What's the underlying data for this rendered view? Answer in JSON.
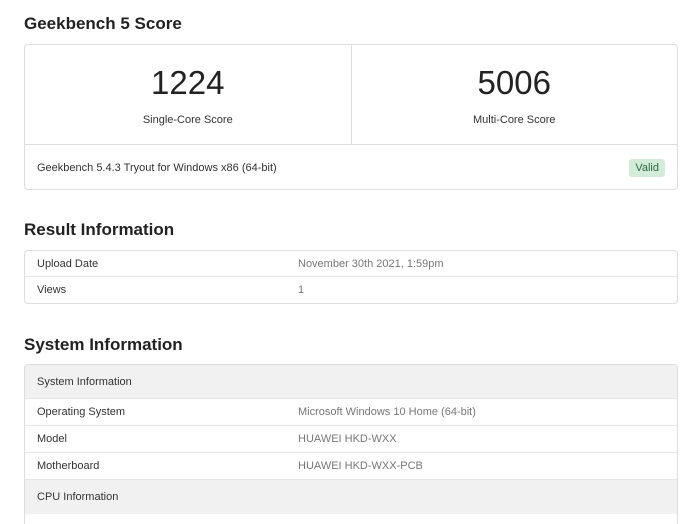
{
  "score_section": {
    "title": "Geekbench 5 Score",
    "single_core": {
      "value": "1224",
      "label": "Single-Core Score"
    },
    "multi_core": {
      "value": "5006",
      "label": "Multi-Core Score"
    },
    "version_text": "Geekbench 5.4.3 Tryout for Windows x86 (64-bit)",
    "status_badge": "Valid",
    "badge_color": "#d3ecd9"
  },
  "result_section": {
    "title": "Result Information",
    "rows": [
      {
        "key": "Upload Date",
        "value": "November 30th 2021, 1:59pm"
      },
      {
        "key": "Views",
        "value": "1"
      }
    ]
  },
  "system_section": {
    "title": "System Information",
    "group_header": "System Information",
    "rows": [
      {
        "key": "Operating System",
        "value": "Microsoft Windows 10 Home (64-bit)"
      },
      {
        "key": "Model",
        "value": "HUAWEI HKD-WXX"
      },
      {
        "key": "Motherboard",
        "value": "HUAWEI HKD-WXX-PCB"
      }
    ],
    "next_group_header": "CPU Information"
  }
}
